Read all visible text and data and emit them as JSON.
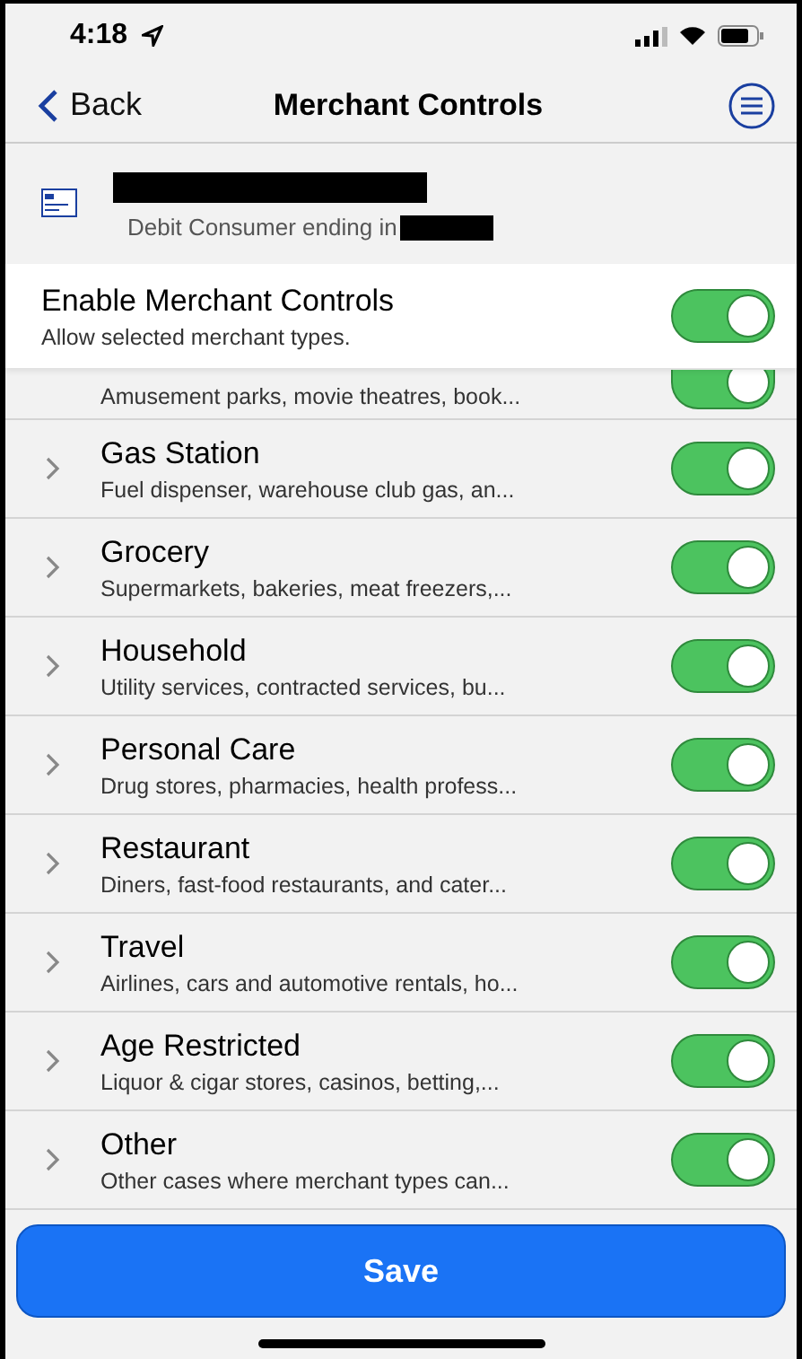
{
  "status_bar": {
    "time": "4:18"
  },
  "nav": {
    "back": "Back",
    "title": "Merchant Controls"
  },
  "account": {
    "subtitle": "Debit Consumer ending in"
  },
  "master": {
    "title": "Enable Merchant Controls",
    "subtitle": "Allow selected merchant types.",
    "on": true
  },
  "categories": [
    {
      "description": "Amusement parks, movie theatres, book...",
      "on": true
    },
    {
      "name": "Gas Station",
      "description": "Fuel dispenser, warehouse club gas, an...",
      "on": true
    },
    {
      "name": "Grocery",
      "description": "Supermarkets, bakeries, meat freezers,...",
      "on": true
    },
    {
      "name": "Household",
      "description": "Utility services, contracted services, bu...",
      "on": true
    },
    {
      "name": "Personal Care",
      "description": "Drug stores, pharmacies, health profess...",
      "on": true
    },
    {
      "name": "Restaurant",
      "description": "Diners, fast-food restaurants, and cater...",
      "on": true
    },
    {
      "name": "Travel",
      "description": "Airlines, cars and automotive rentals, ho...",
      "on": true
    },
    {
      "name": "Age Restricted",
      "description": "Liquor & cigar stores, casinos, betting,...",
      "on": true
    },
    {
      "name": "Other",
      "description": "Other cases where merchant types can...",
      "on": true
    }
  ],
  "save_button": "Save"
}
